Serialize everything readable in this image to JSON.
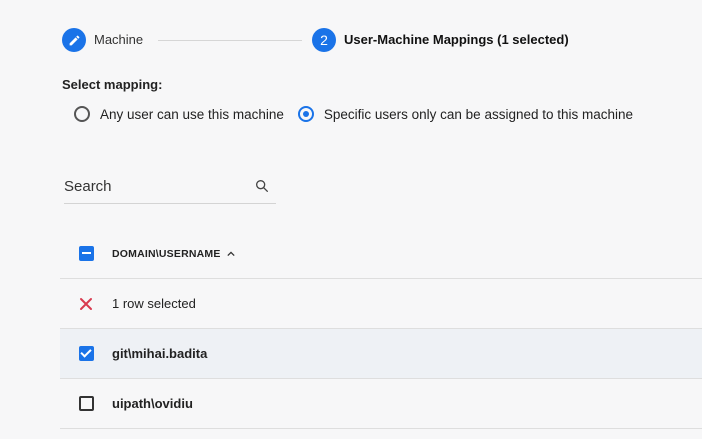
{
  "stepper": {
    "step1": {
      "icon": "pencil-icon",
      "label": "Machine"
    },
    "step2": {
      "number": "2",
      "label": "User-Machine Mappings (1 selected)"
    }
  },
  "mapping": {
    "title": "Select mapping:",
    "options": [
      {
        "label": "Any user can use this machine",
        "selected": false
      },
      {
        "label": "Specific users only can be assigned to this machine",
        "selected": true
      }
    ]
  },
  "search": {
    "placeholder": "Search",
    "icon": "search-icon"
  },
  "table": {
    "column_header": "DOMAIN\\USERNAME",
    "sort_icon": "chevron-up-icon",
    "selection_bar": {
      "icon": "close-icon",
      "text": "1 row selected"
    },
    "rows": [
      {
        "username": "git\\mihai.badita",
        "checked": true
      },
      {
        "username": "uipath\\ovidiu",
        "checked": false
      }
    ]
  },
  "colors": {
    "accent": "#1a73e8",
    "close": "#d93a4f",
    "selected_row": "#eef1f5"
  }
}
